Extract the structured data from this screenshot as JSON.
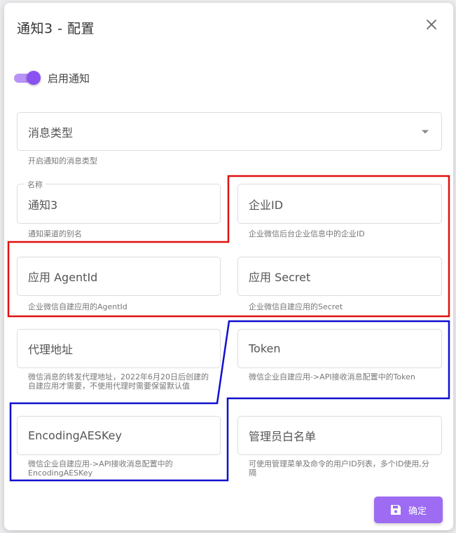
{
  "dialog": {
    "title": "通知3 - 配置"
  },
  "enable_switch": {
    "label": "启用通知",
    "on": true
  },
  "fields": {
    "message_type": {
      "placeholder": "消息类型",
      "hint": "开启通知的消息类型"
    },
    "name": {
      "legend": "名称",
      "value": "通知3",
      "hint": "通知渠道的别名"
    },
    "corp_id": {
      "placeholder": "企业ID",
      "hint": "企业微信后台企业信息中的企业ID"
    },
    "agent_id": {
      "placeholder": "应用 AgentId",
      "hint": "企业微信自建应用的AgentId"
    },
    "secret": {
      "placeholder": "应用 Secret",
      "hint": "企业微信自建应用的Secret"
    },
    "proxy": {
      "placeholder": "代理地址",
      "hint": "微信消息的转发代理地址，2022年6月20日后创建的自建应用才需要，不使用代理时需要保留默认值"
    },
    "token": {
      "placeholder": "Token",
      "hint": "微信企业自建应用->API接收消息配置中的Token"
    },
    "aes_key": {
      "placeholder": "EncodingAESKey",
      "hint": "微信企业自建应用->API接收消息配置中的EncodingAESKey"
    },
    "admin_whitelist": {
      "placeholder": "管理员白名单",
      "hint": "可使用管理菜单及命令的用户ID列表，多个ID使用,分隔"
    }
  },
  "footer": {
    "save_label": "确定"
  },
  "colors": {
    "accent": "#9d6cf3",
    "switch_knob": "#8b52f2",
    "annotation_red": "#e01010",
    "annotation_blue": "#1010d0"
  },
  "icons": {
    "close": "close-icon",
    "save": "save-icon",
    "dropdown": "chevron-down-icon"
  }
}
